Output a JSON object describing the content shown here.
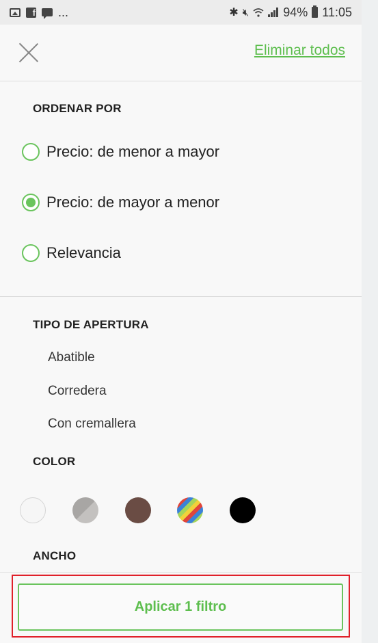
{
  "status_bar": {
    "overflow_label": "...",
    "battery": "94%",
    "time": "11:05",
    "icons": [
      "image-icon",
      "facebook-icon",
      "chat-icon",
      "bluetooth-icon",
      "mute-icon",
      "wifi-icon",
      "signal-icon",
      "battery-icon"
    ]
  },
  "header": {
    "close_icon": "close-icon",
    "clear_all_label": "Eliminar todos"
  },
  "sort": {
    "title": "ORDENAR POR",
    "options": [
      {
        "label": "Precio: de menor a mayor",
        "checked": false
      },
      {
        "label": "Precio: de mayor a menor",
        "checked": true
      },
      {
        "label": "Relevancia",
        "checked": false
      }
    ]
  },
  "opening_type": {
    "title": "TIPO DE APERTURA",
    "options": [
      "Abatible",
      "Corredera",
      "Con cremallera"
    ]
  },
  "color": {
    "title": "COLOR",
    "swatches": [
      {
        "name": "white",
        "color": "#f6f6f6"
      },
      {
        "name": "grey",
        "color": "#a7a5a3"
      },
      {
        "name": "brown",
        "color": "#6a4c44"
      },
      {
        "name": "multicolor",
        "color": "multi"
      },
      {
        "name": "black",
        "color": "#000000"
      }
    ]
  },
  "width": {
    "title": "ANCHO"
  },
  "apply": {
    "label": "Aplicar 1 filtro"
  },
  "colors": {
    "accent": "#6ac45d",
    "highlight": "#e0202a"
  }
}
